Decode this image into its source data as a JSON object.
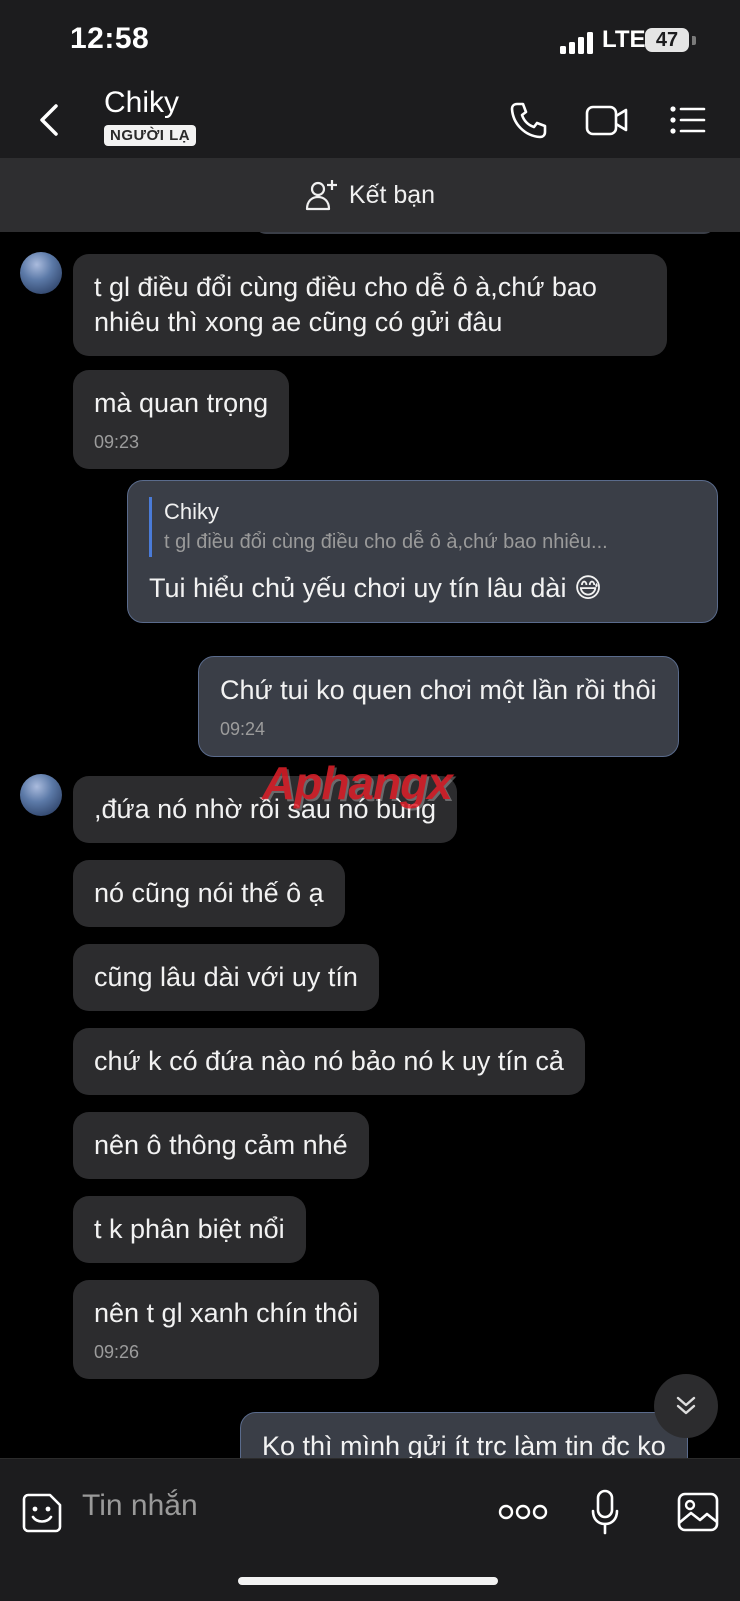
{
  "status_bar": {
    "time": "12:58",
    "network": "LTE",
    "battery": "47"
  },
  "header": {
    "contact_name": "Chiky",
    "badge": "NGƯỜI LẠ"
  },
  "friend_bar": {
    "label": "Kết bạn"
  },
  "messages": [
    {
      "from": "them",
      "text": "t gl điều đổi cùng điều cho dễ ô à,chứ bao nhiêu thì xong ae cũng có gửi đâu"
    },
    {
      "from": "them",
      "text": "mà quan trọng",
      "time": "09:23"
    },
    {
      "from": "me",
      "quote_name": "Chiky",
      "quote_text": "t gl điều đổi cùng điều cho dễ ô à,chứ bao nhiêu...",
      "text": "Tui hiểu chủ yếu chơi uy tín lâu dài 😅"
    },
    {
      "from": "me",
      "text": "Chứ tui ko quen chơi một lần rồi thôi",
      "time": "09:24"
    },
    {
      "from": "them",
      "text": ",đứa nó nhờ rồi sau nó bùng"
    },
    {
      "from": "them",
      "text": "nó cũng nói thế ô ạ"
    },
    {
      "from": "them",
      "text": "cũng lâu dài với uy tín"
    },
    {
      "from": "them",
      "text": "chứ k có đứa nào nó bảo nó k uy tín cả"
    },
    {
      "from": "them",
      "text": "nên ô thông cảm nhé"
    },
    {
      "from": "them",
      "text": "t k phân biệt nổi"
    },
    {
      "from": "them",
      "text": "nên t gl xanh chín thôi",
      "time": "09:26"
    },
    {
      "from": "me",
      "text": "Ko thì mình gửi ít trc làm tin đc ko"
    }
  ],
  "watermark": "Aphangx",
  "composer": {
    "placeholder": "Tin nhắn"
  },
  "icons": {
    "back": "chevron-left-icon",
    "call": "phone-icon",
    "video": "video-camera-icon",
    "menu": "list-menu-icon",
    "add_friend": "add-user-icon",
    "sticker": "sticker-icon",
    "more": "more-dots-icon",
    "mic": "microphone-icon",
    "image": "image-icon",
    "scroll": "double-chevron-down-icon"
  }
}
